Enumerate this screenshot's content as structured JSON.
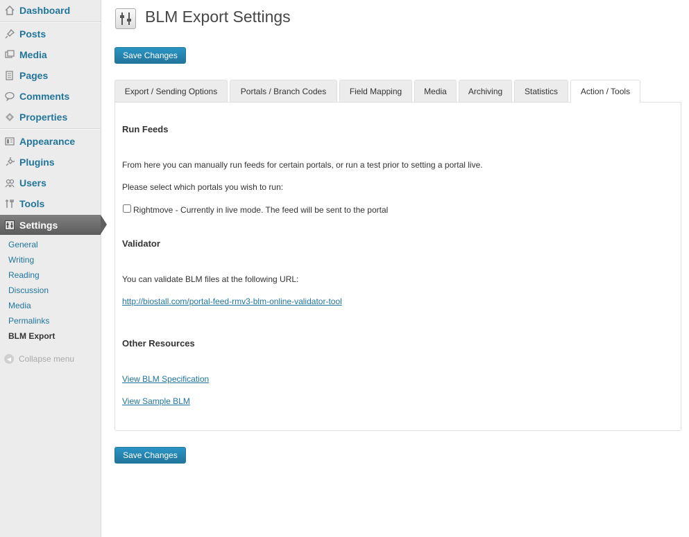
{
  "sidebar": {
    "items": [
      {
        "label": "Dashboard",
        "icon": "dashboard-icon"
      },
      {
        "label": "Posts",
        "icon": "pin-icon"
      },
      {
        "label": "Media",
        "icon": "media-icon"
      },
      {
        "label": "Pages",
        "icon": "pages-icon"
      },
      {
        "label": "Comments",
        "icon": "comments-icon"
      },
      {
        "label": "Properties",
        "icon": "properties-icon"
      },
      {
        "label": "Appearance",
        "icon": "appearance-icon"
      },
      {
        "label": "Plugins",
        "icon": "plugins-icon"
      },
      {
        "label": "Users",
        "icon": "users-icon"
      },
      {
        "label": "Tools",
        "icon": "tools-icon"
      },
      {
        "label": "Settings",
        "icon": "settings-icon"
      }
    ],
    "submenu": [
      "General",
      "Writing",
      "Reading",
      "Discussion",
      "Media",
      "Permalinks",
      "BLM Export"
    ],
    "collapse_label": "Collapse menu"
  },
  "header": {
    "title": "BLM Export Settings",
    "save_label": "Save Changes"
  },
  "tabs": [
    "Export / Sending Options",
    "Portals / Branch Codes",
    "Field Mapping",
    "Media",
    "Archiving",
    "Statistics",
    "Action / Tools"
  ],
  "active_tab": "Action / Tools",
  "run_feeds": {
    "title": "Run Feeds",
    "intro": "From here you can manually run feeds for certain portals, or run a test prior to setting a portal live.",
    "prompt": "Please select which portals you wish to run:",
    "portal_label": "Rightmove - Currently in live mode. The feed will be sent to the portal",
    "portal_checked": false
  },
  "validator": {
    "title": "Validator",
    "text": "You can validate BLM files at the following URL:",
    "url": "http://biostall.com/portal-feed-rmv3-blm-online-validator-tool"
  },
  "other_resources": {
    "title": "Other Resources",
    "spec_link": "View BLM Specification",
    "sample_link": "View Sample BLM"
  },
  "footer": {
    "save_label": "Save Changes"
  },
  "colors": {
    "link": "#21759b",
    "button": "#21759b",
    "sidebar_bg": "#ececec",
    "settings_active": "#6d6d6d"
  }
}
